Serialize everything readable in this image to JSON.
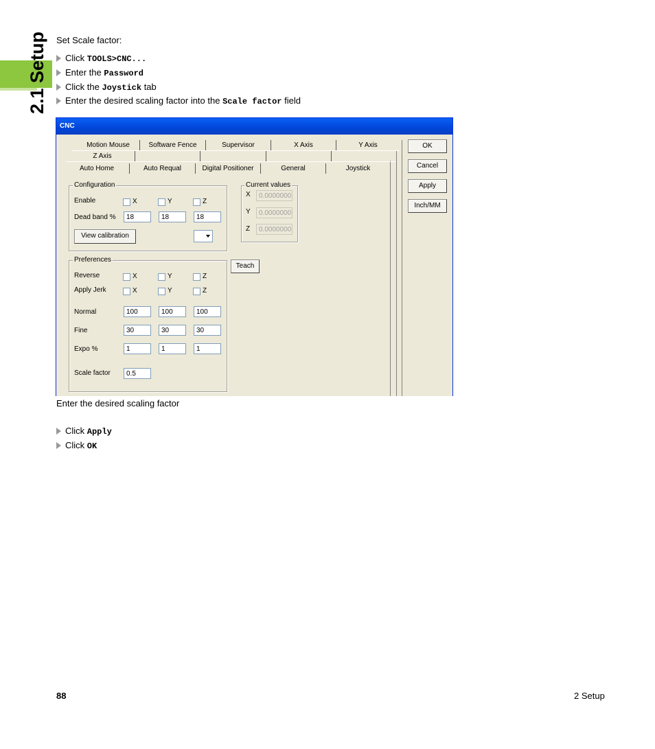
{
  "sidebar": {
    "section_title": "2.1 Setup"
  },
  "intro": "Set Scale factor:",
  "steps": [
    {
      "pre": "Click ",
      "code": "TOOLS>CNC...",
      "post": ""
    },
    {
      "pre": "Enter the ",
      "code": "Password",
      "post": ""
    },
    {
      "pre": "Click the ",
      "code": "Joystick",
      "post": " tab"
    },
    {
      "pre": "Enter the desired scaling factor into the ",
      "code": "Scale factor",
      "post": " field"
    }
  ],
  "dialog": {
    "title": "CNC",
    "tabs_row1": [
      "Motion Mouse",
      "Software Fence",
      "Supervisor",
      "X Axis",
      "Y Axis"
    ],
    "tabs_row2": [
      "Z Axis",
      "",
      "",
      "",
      ""
    ],
    "tabs_row3": [
      "Auto Home",
      "Auto Requal",
      "Digital Positioner",
      "General",
      "Joystick"
    ],
    "configuration": {
      "title": "Configuration",
      "enable_label": "Enable",
      "deadband_label": "Dead band %",
      "axis_labels": [
        "X",
        "Y",
        "Z"
      ],
      "deadband_values": [
        "18",
        "18",
        "18"
      ],
      "view_calibration": "View calibration"
    },
    "current_values": {
      "title": "Current values",
      "axes": [
        "X",
        "Y",
        "Z"
      ],
      "values": [
        "0.0000000",
        "0.0000000",
        "0.0000000"
      ]
    },
    "preferences": {
      "title": "Preferences",
      "reverse_label": "Reverse",
      "apply_jerk_label": "Apply Jerk",
      "normal_label": "Normal",
      "fine_label": "Fine",
      "expo_label": "Expo %",
      "scale_label": "Scale factor",
      "normal_values": [
        "100",
        "100",
        "100"
      ],
      "fine_values": [
        "30",
        "30",
        "30"
      ],
      "expo_values": [
        "1",
        "1",
        "1"
      ],
      "scale_value": "0.5"
    },
    "teach": "Teach",
    "buttons": {
      "ok": "OK",
      "cancel": "Cancel",
      "apply": "Apply",
      "inch_mm": "Inch/MM"
    }
  },
  "caption": "Enter the desired scaling factor",
  "after_steps": [
    {
      "pre": "Click ",
      "code": "Apply"
    },
    {
      "pre": "Click ",
      "code": "OK"
    }
  ],
  "footer": {
    "page_number": "88",
    "chapter": "2 Setup"
  }
}
